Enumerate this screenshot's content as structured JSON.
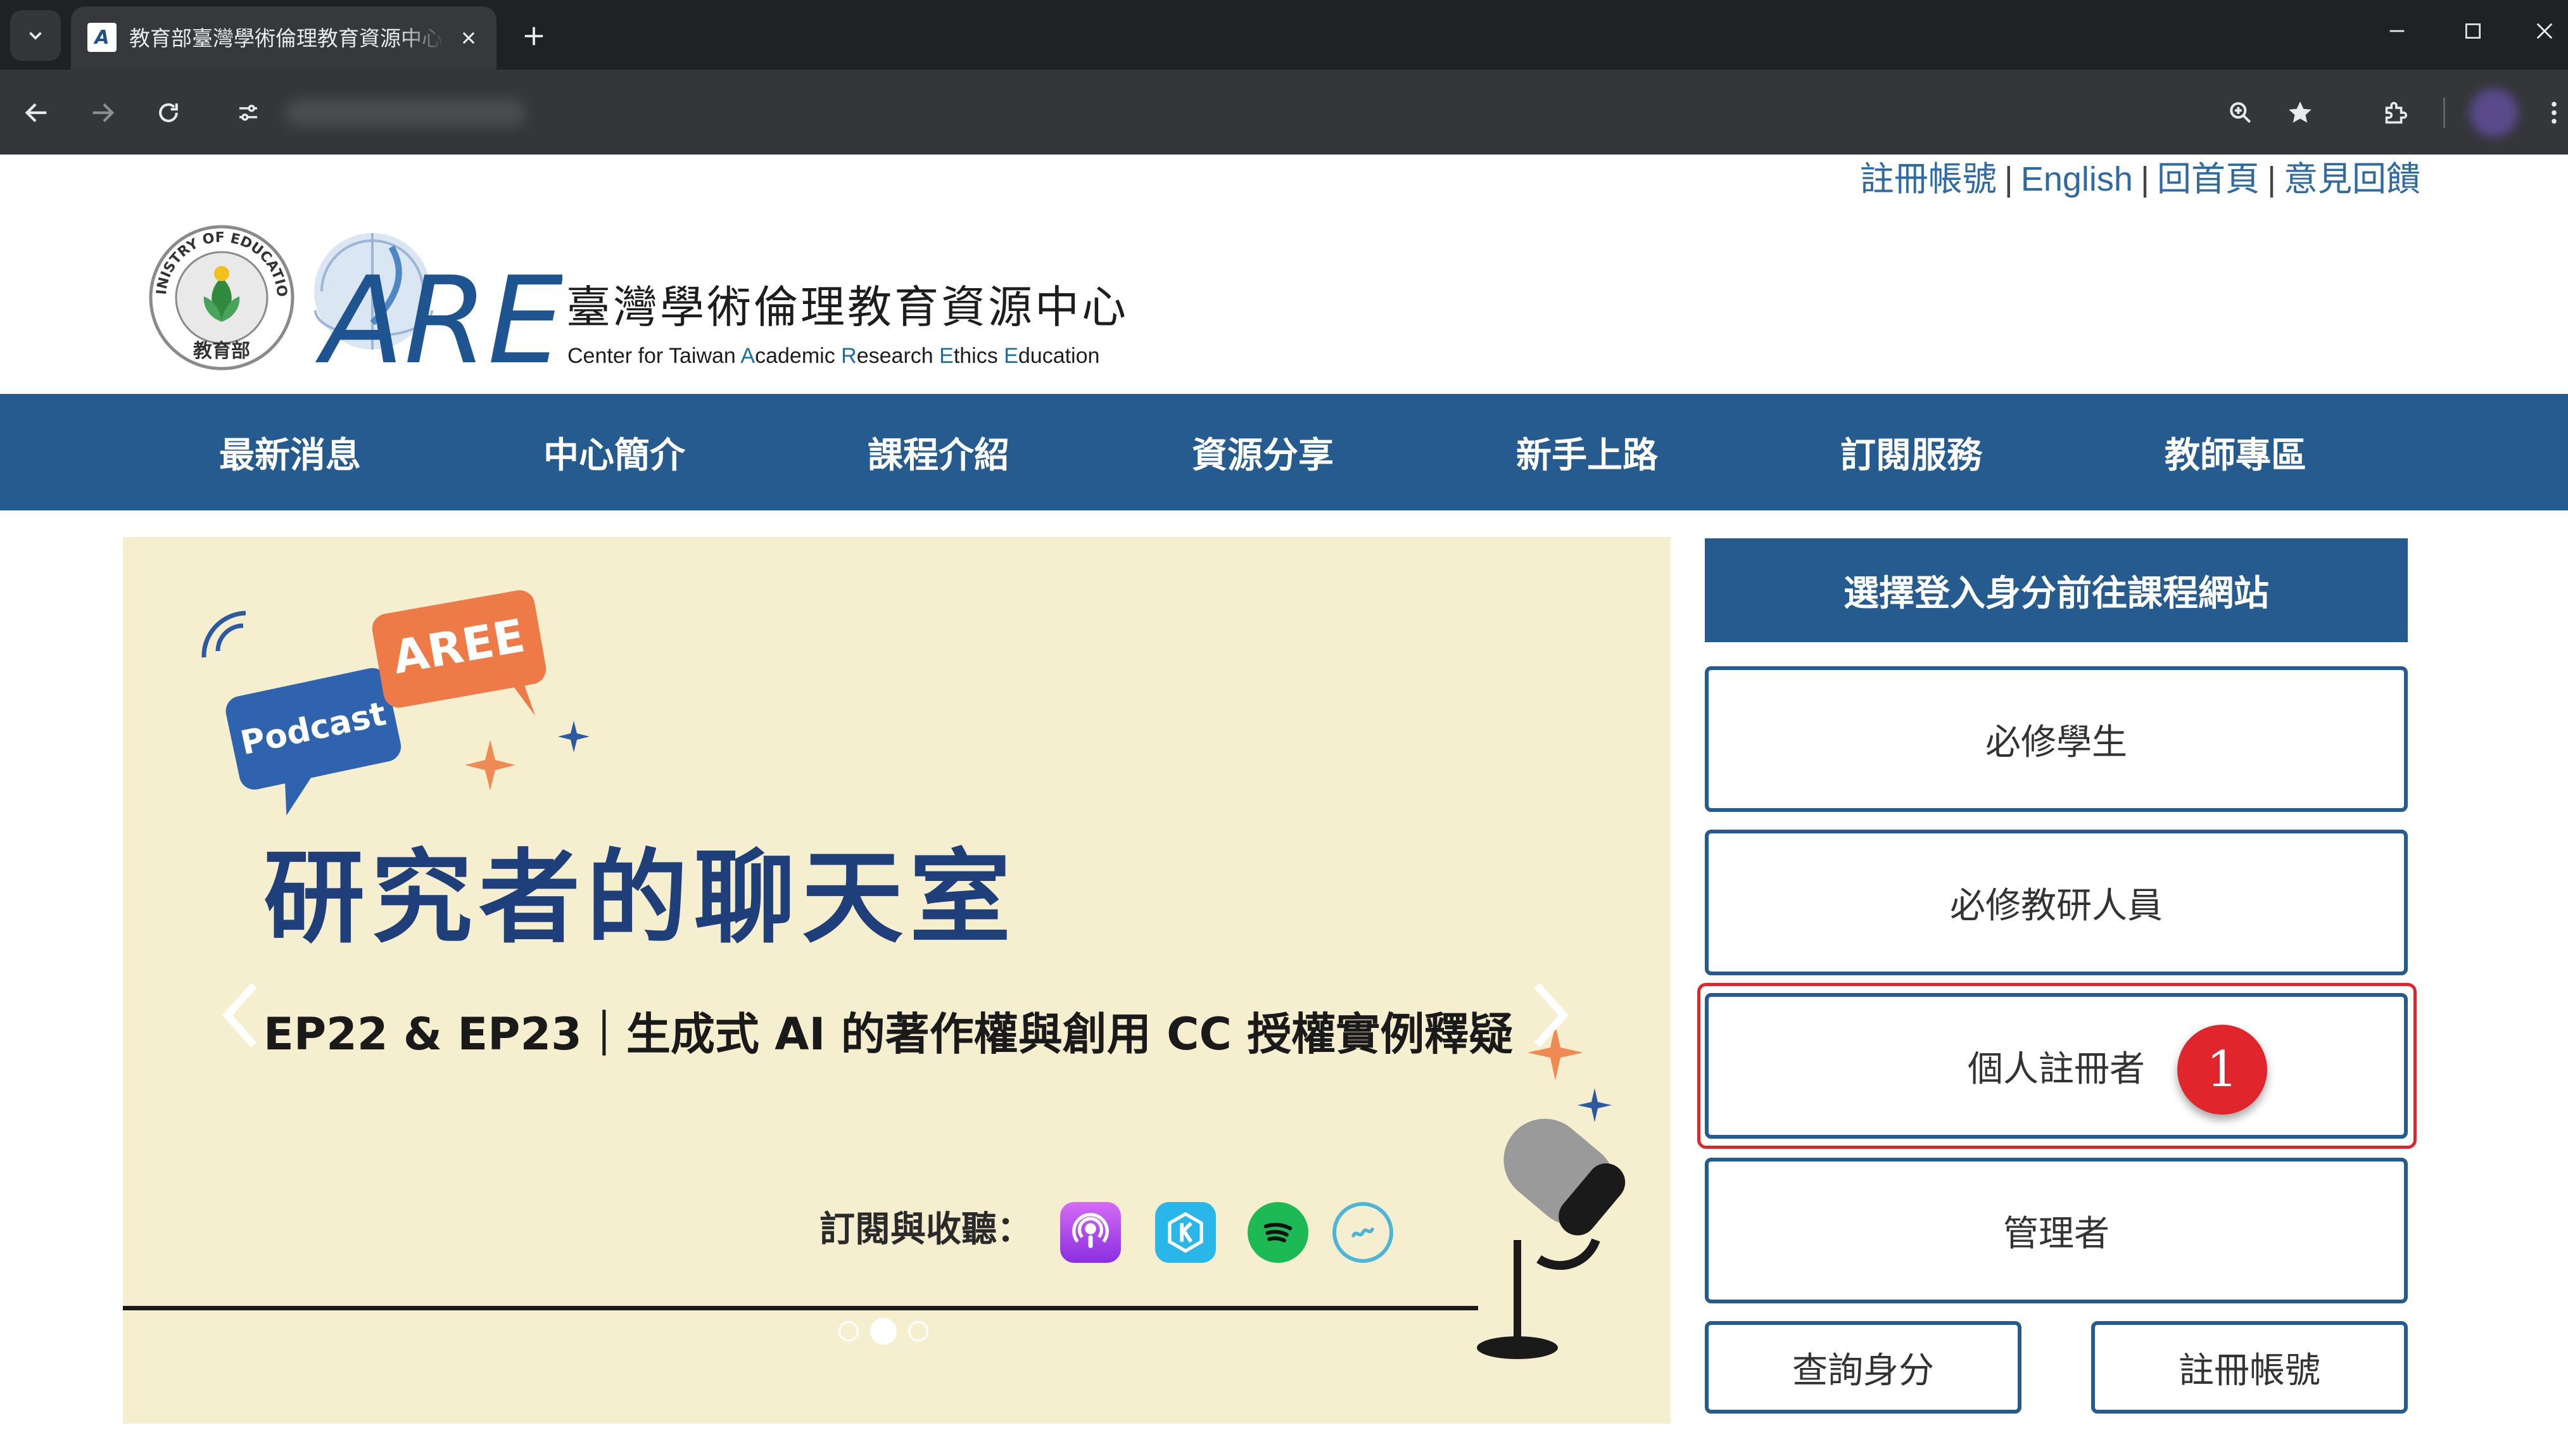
{
  "browser": {
    "tab_title": "教育部臺灣學術倫理教育資源中心",
    "url": ""
  },
  "top_links": {
    "register": "註冊帳號",
    "english": "English",
    "home": "回首頁",
    "feedback": "意見回饋",
    "separator": "|"
  },
  "header": {
    "org_name_zh": "臺灣學術倫理教育資源中心",
    "org_name_en": {
      "part1": "Center for Taiwan ",
      "hl1": "A",
      "part2": "cademic ",
      "hl2": "R",
      "part3": "esearch ",
      "hl3": "E",
      "part4": "thics ",
      "hl4": "E",
      "part5": "ducation"
    },
    "moe_seal_text": "MINISTRY OF EDUCATION",
    "moe_seal_bottom": "教育部",
    "logo_text": "AREE"
  },
  "nav": {
    "items": [
      "最新消息",
      "中心簡介",
      "課程介紹",
      "資源分享",
      "新手上路",
      "訂閱服務",
      "教師專區"
    ]
  },
  "banner": {
    "badge_aree": "AREE",
    "badge_podcast": "Podcast",
    "title": "研究者的聊天室",
    "subtitle": "EP22 & EP23｜生成式 AI 的著作權與創用 CC 授權實例釋疑",
    "subscribe_label": "訂閱與收聽：",
    "platform_icons": [
      "apple-podcasts-icon",
      "kkbox-icon",
      "spotify-icon",
      "soundon-icon"
    ],
    "slide_count": 3,
    "active_slide": 2
  },
  "login_panel": {
    "heading": "選擇登入身分前往課程網站",
    "roles": [
      "必修學生",
      "必修教研人員",
      "個人註冊者",
      "管理者"
    ],
    "highlighted_role": "個人註冊者",
    "step_badge": "1",
    "query_button": "查詢身分",
    "register_button": "註冊帳號"
  },
  "colors": {
    "brand_blue": "#265b8f",
    "link_blue": "#2e6aa3",
    "banner_bg": "#f6efcf",
    "title_navy": "#1f3f7a",
    "highlight_red": "#e0252b"
  }
}
